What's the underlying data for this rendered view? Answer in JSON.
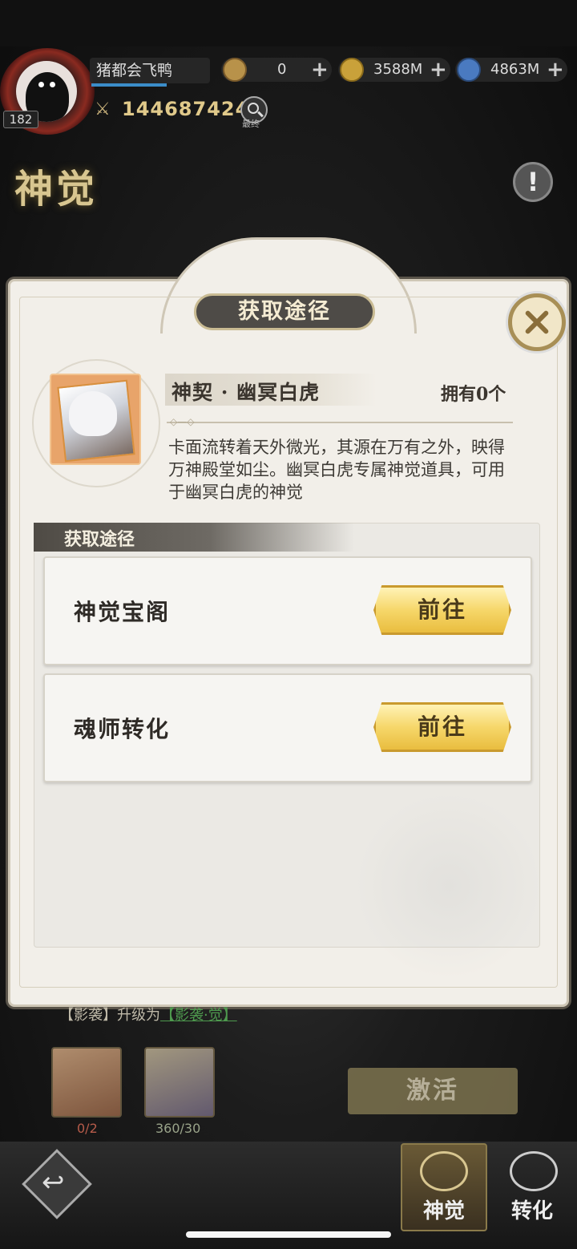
{
  "hud": {
    "player_name": "猪都会飞鸭",
    "level": "182",
    "power": "144687424",
    "search_label": "最终",
    "currencies": [
      {
        "value": "0"
      },
      {
        "value": "3588M"
      },
      {
        "value": "4863M"
      }
    ],
    "page_title": "神觉",
    "info_symbol": "!"
  },
  "modal": {
    "title": "获取途径",
    "item": {
      "name": "神契 · 幽冥白虎",
      "owned": "拥有0个",
      "description": "卡面流转着天外微光，其源在万有之外，映得万神殿堂如尘。幽冥白虎专属神觉道具，可用于幽冥白虎的神觉"
    },
    "section_title": "获取途径",
    "sources": [
      {
        "label": "神觉宝阁",
        "button": "前往"
      },
      {
        "label": "魂师转化",
        "button": "前往"
      }
    ]
  },
  "background": {
    "note_prefix": "【影袭】升级为",
    "note_link": "【影袭·觉】",
    "slot1_count": "0/2",
    "slot2_count": "360/30",
    "activate_label": "激活"
  },
  "bottom": {
    "tab_awaken": "神觉",
    "tab_transform": "转化"
  },
  "colors": {
    "accent_gold": "#e0c98a",
    "button_gold": "#f6d76a",
    "modal_bg": "#f2efe9",
    "title_bar": "#4e4b47"
  }
}
